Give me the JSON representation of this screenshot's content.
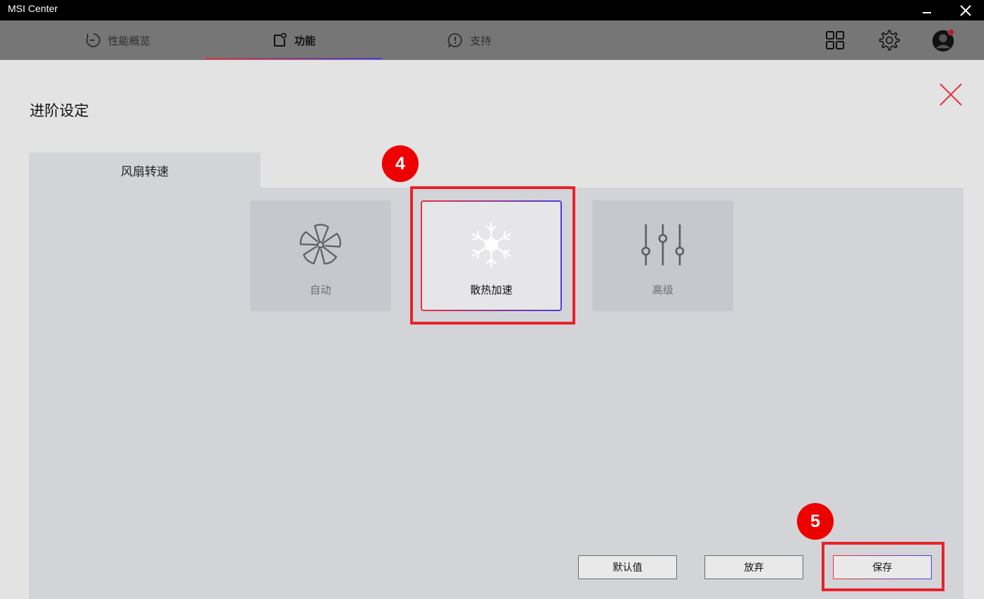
{
  "window": {
    "title": "MSI Center",
    "minimize_icon": "minimize-icon",
    "close_icon": "close-icon"
  },
  "nav": {
    "tabs": [
      {
        "label": "性能概览",
        "icon": "gauge-icon",
        "active": false
      },
      {
        "label": "功能",
        "icon": "feature-icon",
        "active": true
      },
      {
        "label": "支持",
        "icon": "chat-alert-icon",
        "active": false
      }
    ],
    "right_icons": [
      "apps-grid-icon",
      "gear-icon",
      "avatar"
    ],
    "accent_gradient": [
      "#e8313a",
      "#4a3be0"
    ]
  },
  "page": {
    "title": "进阶设定",
    "close_icon": "close-x-icon",
    "section_tab": "风扇转速"
  },
  "modes": [
    {
      "label": "自动",
      "icon": "fan-icon",
      "selected": false
    },
    {
      "label": "散热加速",
      "icon": "snowflake-icon",
      "selected": true
    },
    {
      "label": "高级",
      "icon": "sliders-icon",
      "selected": false
    }
  ],
  "annotations": {
    "step_a": "4",
    "step_b": "5",
    "color": "#e8222b"
  },
  "actions": {
    "default_label": "默认值",
    "discard_label": "放弃",
    "save_label": "保存"
  }
}
